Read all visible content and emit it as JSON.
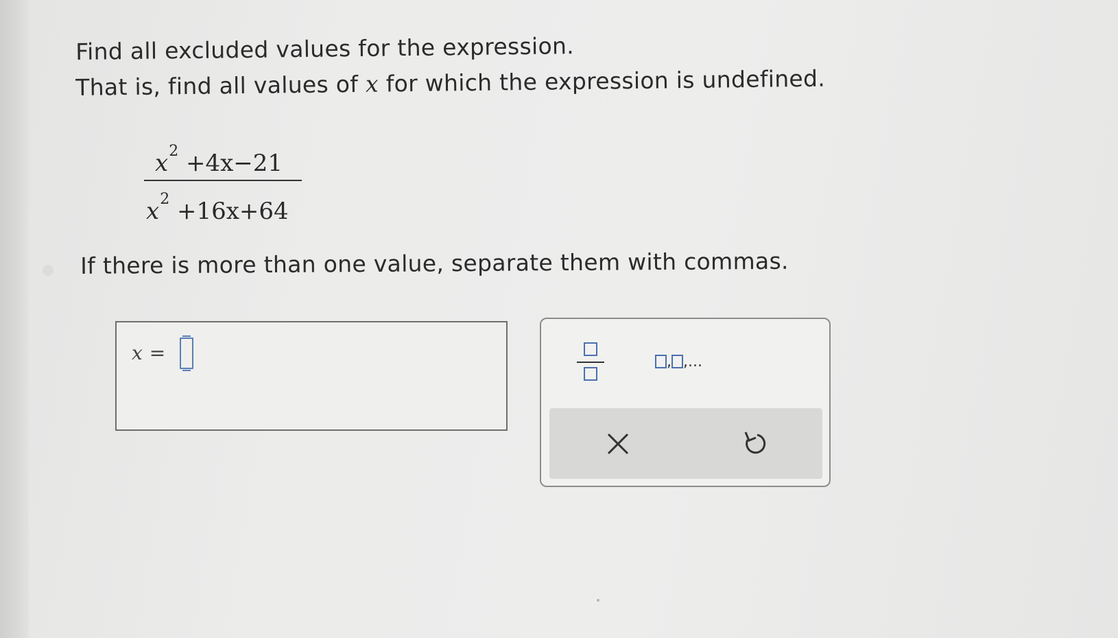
{
  "question": {
    "line1": "Find all excluded values for the expression.",
    "line2_prefix": "That is, find all values of ",
    "line2_var": "x",
    "line2_suffix": " for which the expression is undefined.",
    "instruction": "If there is more than one value, separate them with commas."
  },
  "expression": {
    "numerator": {
      "var": "x",
      "exponent": "2",
      "rest": " +4x−21"
    },
    "denominator": {
      "var": "x",
      "exponent": "2",
      "rest": " +16x+64"
    }
  },
  "answer": {
    "label_var": "x",
    "label_eq": "=",
    "value": ""
  },
  "toolbox": {
    "fraction_tool": "fraction-template",
    "list_tool_suffix": ",...",
    "clear_icon": "close-icon",
    "undo_icon": "undo-icon"
  },
  "colors": {
    "slot_blue": "#5a7fb8",
    "text": "#2b2b2b",
    "action_bar": "#d8d8d7"
  }
}
